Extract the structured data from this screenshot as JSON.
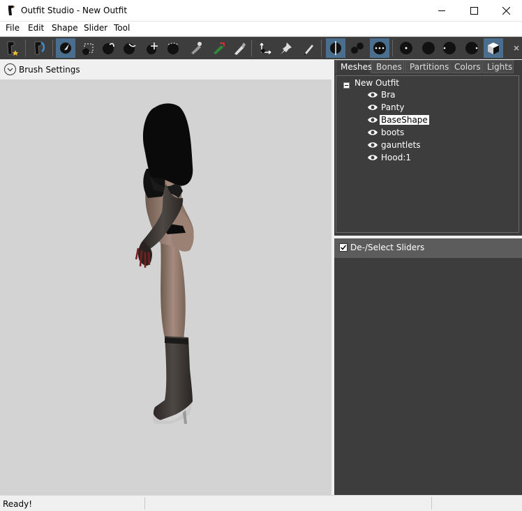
{
  "window": {
    "title": "Outfit Studio - New Outfit"
  },
  "menu": [
    "File",
    "Edit",
    "Shape",
    "Slider",
    "Tool"
  ],
  "toolbar": {
    "buttons": [
      "new-project-icon",
      "load-project-icon",
      "select-brush-icon",
      "mask-brush-icon",
      "inflate-brush-icon",
      "deflate-brush-icon",
      "move-brush-icon",
      "smooth-brush-icon",
      "undiff-brush-icon",
      "weight-brush-icon",
      "color-brush-icon",
      "transform-icon",
      "pivot-icon",
      "edit-vertices-icon",
      "mirror-icon",
      "connected-only-icon",
      "global-brush-icon",
      "vertex-view-icon",
      "wireframe-icon",
      "lighting-icon",
      "texture-icon",
      "xray-icon",
      "mask-view-icon"
    ]
  },
  "brush_settings": {
    "label": "Brush Settings"
  },
  "tabs": [
    {
      "label": "Meshes",
      "active": true
    },
    {
      "label": "Bones",
      "active": false
    },
    {
      "label": "Partitions",
      "active": false
    },
    {
      "label": "Colors",
      "active": false
    },
    {
      "label": "Lights",
      "active": false
    }
  ],
  "mesh_tree": {
    "root": "New Outfit",
    "items": [
      {
        "label": "Bra",
        "selected": false
      },
      {
        "label": "Panty",
        "selected": false
      },
      {
        "label": "BaseShape",
        "selected": true
      },
      {
        "label": "boots",
        "selected": false
      },
      {
        "label": "gauntlets",
        "selected": false
      },
      {
        "label": "Hood:1",
        "selected": false
      }
    ]
  },
  "sliders": {
    "header": "De-/Select Sliders",
    "checked": true
  },
  "status": {
    "text": "Ready!"
  },
  "colors": {
    "accent": "#4a6f8e",
    "panel": "#3d3d3d",
    "viewport": "#d3d3d3"
  }
}
